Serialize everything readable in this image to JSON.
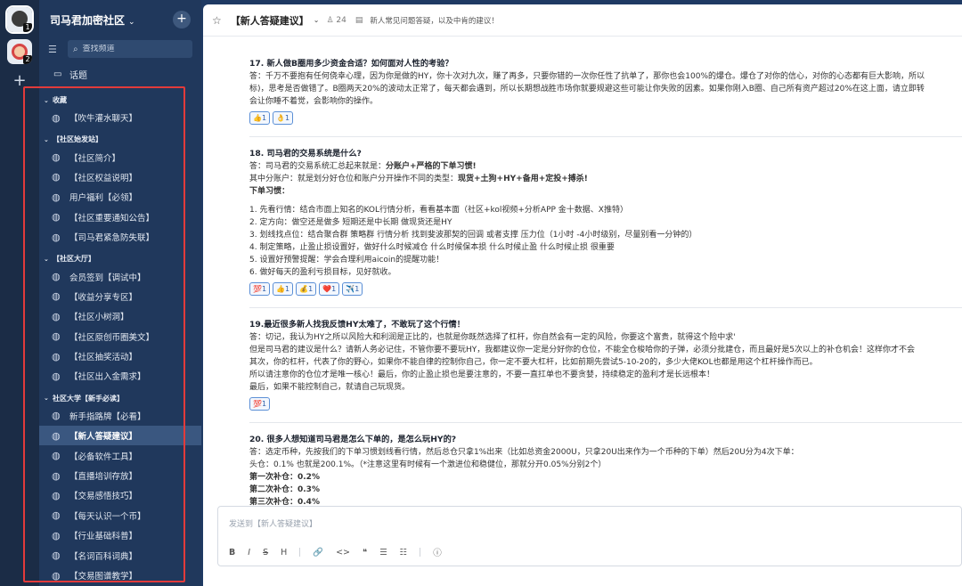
{
  "rail": {
    "servers": [
      {
        "badge": "1"
      },
      {
        "badge": "2"
      }
    ],
    "add": "+"
  },
  "sidebar": {
    "title": "司马君加密社区",
    "search_placeholder": "查找频道",
    "topic": "话题",
    "groups": [
      {
        "label": "收藏",
        "channels": [
          "【吹牛灌水聊天】"
        ]
      },
      {
        "label": "【社区始发站】",
        "channels": [
          "【社区简介】",
          "【社区权益说明】",
          "用户福利【必领】",
          "【社区重要通知公告】",
          "【司马君紧急防失联】"
        ]
      },
      {
        "label": "【社区大厅】",
        "channels": [
          "会员签到【调试中】",
          "【收益分享专区】",
          "【社区小树洞】",
          "【社区原创币圈美文】",
          "【社区抽奖活动】",
          "【社区出入金需求】"
        ]
      },
      {
        "label": "社区大学【新手必读】",
        "channels": [
          "新手指路牌【必看】",
          "【新人答疑建议】",
          "【必备软件工具】",
          "【直播培训存放】",
          "【交易感悟技巧】",
          "【每天认识一个币】",
          "【行业基础科普】",
          "【名词百科词典】",
          "【交易图谱教学】"
        ]
      }
    ],
    "active_channel": "【新人答疑建议】"
  },
  "header": {
    "channel": "【新人答疑建议】",
    "members": "24",
    "description": "新人常见问题答疑，以及中肯的建议！"
  },
  "messages": {
    "m17": {
      "title": "17. 新人做B圈用多少资金合适？如何面对人性的考验？",
      "l1": "答：千万不要抱有任何侥幸心理，因为你是做的HY，你十次对九次，赚了再多，只要你错的一次你任性了抗单了，那你也会100%的爆仓。爆仓了对你的信心，对你的心态都有巨大影响，所以",
      "l2": "标)，思考是否做错了。B圈两天20%的波动太正常了，每天都会遇到，所以长期想战胜市场你就要规避这些可能让你失败的因素。如果你刚入B圈、自己所有资产超过20%在这上面，请立即转",
      "l3": "会让你睡不着觉，会影响你的操作。",
      "reactions": [
        "👍1",
        "👌1"
      ]
    },
    "m18": {
      "title": "18. 司马君的交易系统是什么?",
      "l1a": "答：司马君的交易系统汇总起来就是：",
      "l1b": "分账户+严格的下单习惯!",
      "l2a": "其中分账户：就是划分好仓位和账户分开操作不同的类型：",
      "l2b": "现货+土狗+HY+备用+定投+搏杀!",
      "l3": "下单习惯：",
      "items": [
        "1. 先看行情：结合市面上知名的KOL行情分析，看看基本面（社区+kol视频+分析APP 金十数据、X推特）",
        "2. 定方向：做空还是做多 短期还是中长期 做现货还是HY",
        "3. 划线找点位：结合聚合群 策略群 行情分析 找到斐波那契的回调 或者支撑 压力位（1小时 -4小时级别，尽量别看一分钟的）",
        "4. 制定策略，止盈止损设置好，做好什么时候减仓 什么时候保本损 什么时候止盈 什么时候止损 很重要",
        "5. 设置好预警提醒：学会合理利用aicoin的提醒功能！",
        "6. 做好每天的盈利亏损目标，见好就收。"
      ],
      "reactions": [
        "💯1",
        "👍1",
        "💰1",
        "❤️1",
        "✈️1"
      ]
    },
    "m19": {
      "title": "19.最近很多新人找我反馈HY太难了，不敢玩了这个行情！",
      "lines": [
        "答：切记，我认为HY之所以风险大和利润是正比的，也就是你既然选择了杠杆，你自然会有一定的风险，你要这个富贵，就得这个险中求'",
        "但是司马君的建议是什么？请新人务必记住，不管你要不要玩HY，我都建议你一定是分好你的仓位，不能全仓梭哈你的子弹，必须分批建仓，而且最好是5次以上的补仓机会！这样你才不会",
        "其次，你的杠杆，代表了你的野心，如果你不能自律的控制你自己，你一定不要大杠杆，比如前期先尝试5-10-20的，多少大佬KOL也都是用这个杠杆操作而已。",
        "所以请注意你的仓位才是唯一核心！最后，你的止盈止损也是要注意的，不要一直扛单也不要贪婪，持续稳定的盈利才是长远根本！",
        "最后，如果不能控制自己，就请自己玩现货。"
      ],
      "reactions": [
        "💯1"
      ]
    },
    "m20": {
      "title": "20. 很多人想知道司马君是怎么下单的，是怎么玩HY的?",
      "l1": "答：选定币种，先按我们的下单习惯划线看行情，然后总仓只拿1%出来（比如总资金2000U，只拿20U出来作为一个币种的下单）然后20U分为4次下单：",
      "l2": "头仓：0.1% 也就是200.1%。（*注意这里有时候有一个激进位和稳健位，那就分开0.05%分别2个）",
      "b1": "第一次补仓：0.2%",
      "b2": "第二次补仓：0.3%",
      "b3": "第三次补仓：0.4%"
    }
  },
  "composer": {
    "placeholder": "发送到【新人答疑建议】",
    "tools": [
      "B",
      "I",
      "S",
      "H",
      "🔗",
      "<>",
      "❝",
      "☰",
      "☷",
      "ⓘ"
    ]
  }
}
